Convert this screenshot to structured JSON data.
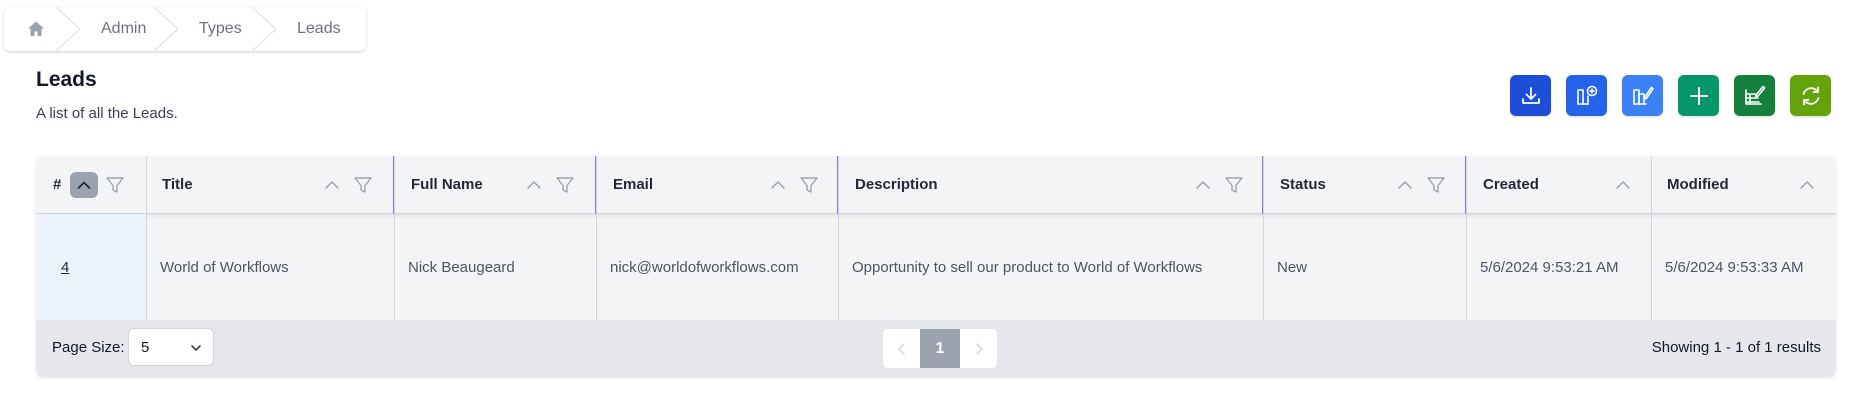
{
  "breadcrumb": {
    "home_icon": "home-icon",
    "items": [
      "Admin",
      "Types",
      "Leads"
    ]
  },
  "header": {
    "title": "Leads",
    "description": "A list of all the Leads."
  },
  "actions": [
    {
      "name": "download-button",
      "icon": "download-icon",
      "color": "#1d4ed8"
    },
    {
      "name": "add-column-button",
      "icon": "columns-add-icon",
      "color": "#2563eb"
    },
    {
      "name": "edit-columns-button",
      "icon": "columns-edit-icon",
      "color": "#3b82f6"
    },
    {
      "name": "add-button",
      "icon": "plus-icon",
      "color": "#059669"
    },
    {
      "name": "edit-list-button",
      "icon": "list-edit-icon",
      "color": "#15803d"
    },
    {
      "name": "refresh-button",
      "icon": "refresh-icon",
      "color": "#65a30d"
    }
  ],
  "table": {
    "columns": [
      {
        "key": "id",
        "label": "#"
      },
      {
        "key": "title",
        "label": "Title"
      },
      {
        "key": "full_name",
        "label": "Full Name"
      },
      {
        "key": "email",
        "label": "Email"
      },
      {
        "key": "description",
        "label": "Description"
      },
      {
        "key": "status",
        "label": "Status"
      },
      {
        "key": "created",
        "label": "Created"
      },
      {
        "key": "modified",
        "label": "Modified"
      }
    ],
    "rows": [
      {
        "id": "4",
        "title": "World of Workflows",
        "full_name": "Nick Beaugeard",
        "email": "nick@worldofworkflows.com",
        "description": "Opportunity to sell our product to World of Workflows",
        "status": "New",
        "created": "5/6/2024 9:53:21 AM",
        "modified": "5/6/2024 9:53:33 AM"
      }
    ]
  },
  "footer": {
    "page_size_label": "Page Size:",
    "page_size_value": "5",
    "current_page": "1",
    "showing": "Showing 1 - 1 of 1 results"
  }
}
